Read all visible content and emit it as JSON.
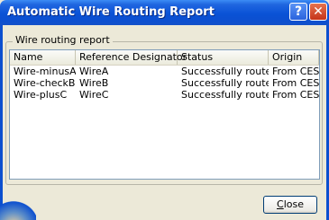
{
  "window": {
    "title": "Automatic Wire Routing Report",
    "help_label": "?",
    "close_glyph": "✕"
  },
  "group": {
    "label": "Wire routing report"
  },
  "table": {
    "columns": [
      "Name",
      "Reference Designator",
      "Status",
      "Origin"
    ],
    "rows": [
      [
        "Wire-minusA",
        "WireA",
        "Successfully routed",
        "From CES"
      ],
      [
        "Wire-checkB",
        "WireB",
        "Successfully routed",
        "From CES"
      ],
      [
        "Wire-plusC",
        "WireC",
        "Successfully routed",
        "From CES"
      ]
    ]
  },
  "buttons": {
    "close_first": "C",
    "close_rest": "lose"
  },
  "colors": {
    "titlebar": "#0c4fcf",
    "dialog_bg": "#ece9d8"
  }
}
